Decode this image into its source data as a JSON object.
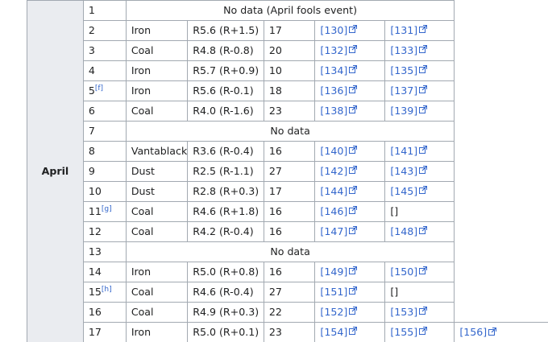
{
  "month": "April",
  "rows": [
    {
      "day": "1",
      "note": "No data (April fools event)"
    },
    {
      "day": "2",
      "type": "Iron",
      "rating": "R5.6 (R+1.5)",
      "count": "17",
      "ref1": "[130]",
      "ref2": "[131]"
    },
    {
      "day": "3",
      "type": "Coal",
      "rating": "R4.8 (R-0.8)",
      "count": "20",
      "ref1": "[132]",
      "ref2": "[133]"
    },
    {
      "day": "4",
      "type": "Iron",
      "rating": "R5.7 (R+0.9)",
      "count": "10",
      "ref1": "[134]",
      "ref2": "[135]"
    },
    {
      "day": "5",
      "footnote": "[f]",
      "type": "Iron",
      "rating": "R5.6 (R-0.1)",
      "count": "18",
      "ref1": "[136]",
      "ref2": "[137]"
    },
    {
      "day": "6",
      "type": "Coal",
      "rating": "R4.0 (R-1.6)",
      "count": "23",
      "ref1": "[138]",
      "ref2": "[139]"
    },
    {
      "day": "7",
      "note": "No data"
    },
    {
      "day": "8",
      "type": "Vantablack",
      "rating": "R3.6 (R-0.4)",
      "count": "16",
      "ref1": "[140]",
      "ref2": "[141]"
    },
    {
      "day": "9",
      "type": "Dust",
      "rating": "R2.5 (R-1.1)",
      "count": "27",
      "ref1": "[142]",
      "ref2": "[143]"
    },
    {
      "day": "10",
      "type": "Dust",
      "rating": "R2.8 (R+0.3)",
      "count": "17",
      "ref1": "[144]",
      "ref2": "[145]"
    },
    {
      "day": "11",
      "footnote": "[g]",
      "type": "Coal",
      "rating": "R4.6 (R+1.8)",
      "count": "16",
      "ref1": "[146]",
      "ref2_plain": "[]"
    },
    {
      "day": "12",
      "type": "Coal",
      "rating": "R4.2 (R-0.4)",
      "count": "16",
      "ref1": "[147]",
      "ref2": "[148]"
    },
    {
      "day": "13",
      "note": "No data"
    },
    {
      "day": "14",
      "type": "Iron",
      "rating": "R5.0 (R+0.8)",
      "count": "16",
      "ref1": "[149]",
      "ref2": "[150]"
    },
    {
      "day": "15",
      "footnote": "[h]",
      "type": "Coal",
      "rating": "R4.6 (R-0.4)",
      "count": "27",
      "ref1": "[151]",
      "ref2_plain": "[]"
    },
    {
      "day": "16",
      "type": "Coal",
      "rating": "R4.9 (R+0.3)",
      "count": "22",
      "ref1": "[152]",
      "ref2": "[153]"
    },
    {
      "day": "17",
      "type": "Iron",
      "rating": "R5.0 (R+0.1)",
      "count": "23",
      "ref1": "[154]",
      "ref2": "[155]",
      "ref3": "[156]"
    }
  ],
  "icons": {
    "external_link": "external-link-icon"
  },
  "colors": {
    "link": "#3366cc",
    "border": "#a2a9b1",
    "header_bg": "#eaecf0",
    "text": "#202122"
  }
}
